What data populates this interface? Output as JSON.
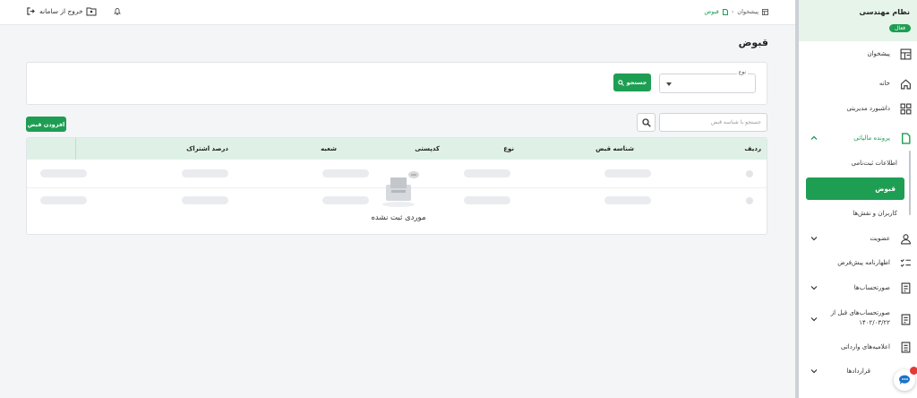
{
  "topbar": {
    "logout_label": "خروج از سامانه",
    "breadcrumb": [
      {
        "label": "پیشخوان"
      },
      {
        "label": "قبوض"
      }
    ]
  },
  "page": {
    "title": "قبوض"
  },
  "filters": {
    "type_label": "نوع",
    "type_value": "",
    "search_button": "جستجو"
  },
  "toolbar": {
    "search_placeholder": "جستجو با شناسه قبض",
    "add_button": "افزودن قبض"
  },
  "table": {
    "columns": [
      "ردیف",
      "شناسه قبض",
      "نوع",
      "کدپستی",
      "شعبه",
      "درصد اشتراک"
    ],
    "empty_text": "موردی ثبت نشده"
  },
  "sidebar": {
    "system_title": "نظام مهندسی",
    "status_badge": "فعال",
    "items": [
      {
        "label": "پیشخوان",
        "icon": "dashboard-icon"
      },
      {
        "label": "خانه",
        "icon": "home-icon"
      },
      {
        "label": "داشبورد مدیریتی",
        "icon": "grid-icon"
      },
      {
        "label": "پرونده مالیاتی",
        "icon": "file-icon"
      },
      {
        "label": "عضویت",
        "icon": "user-icon"
      },
      {
        "label": "اظهارنامه پیش‌فرض",
        "icon": "checklist-icon"
      },
      {
        "label": "صورتحساب‌ها",
        "icon": "invoice-icon"
      },
      {
        "label": "صورتحساب‌های قبل از ۱۴۰۲/۰۳/۲۲",
        "icon": "invoice-icon"
      },
      {
        "label": "اعلامیه‌های وارداتی",
        "icon": "import-icon"
      },
      {
        "label": "قراردادها",
        "icon": "contract-icon"
      }
    ],
    "sub_items": [
      {
        "label": "اطلاعات ثبت‌نامی"
      },
      {
        "label": "قبوض"
      },
      {
        "label": "کاربران و نقش‌ها"
      }
    ]
  },
  "colors": {
    "accent": "#1e9e53",
    "table_header": "#dff1e6",
    "sidebar_head": "#e6f4ea"
  }
}
